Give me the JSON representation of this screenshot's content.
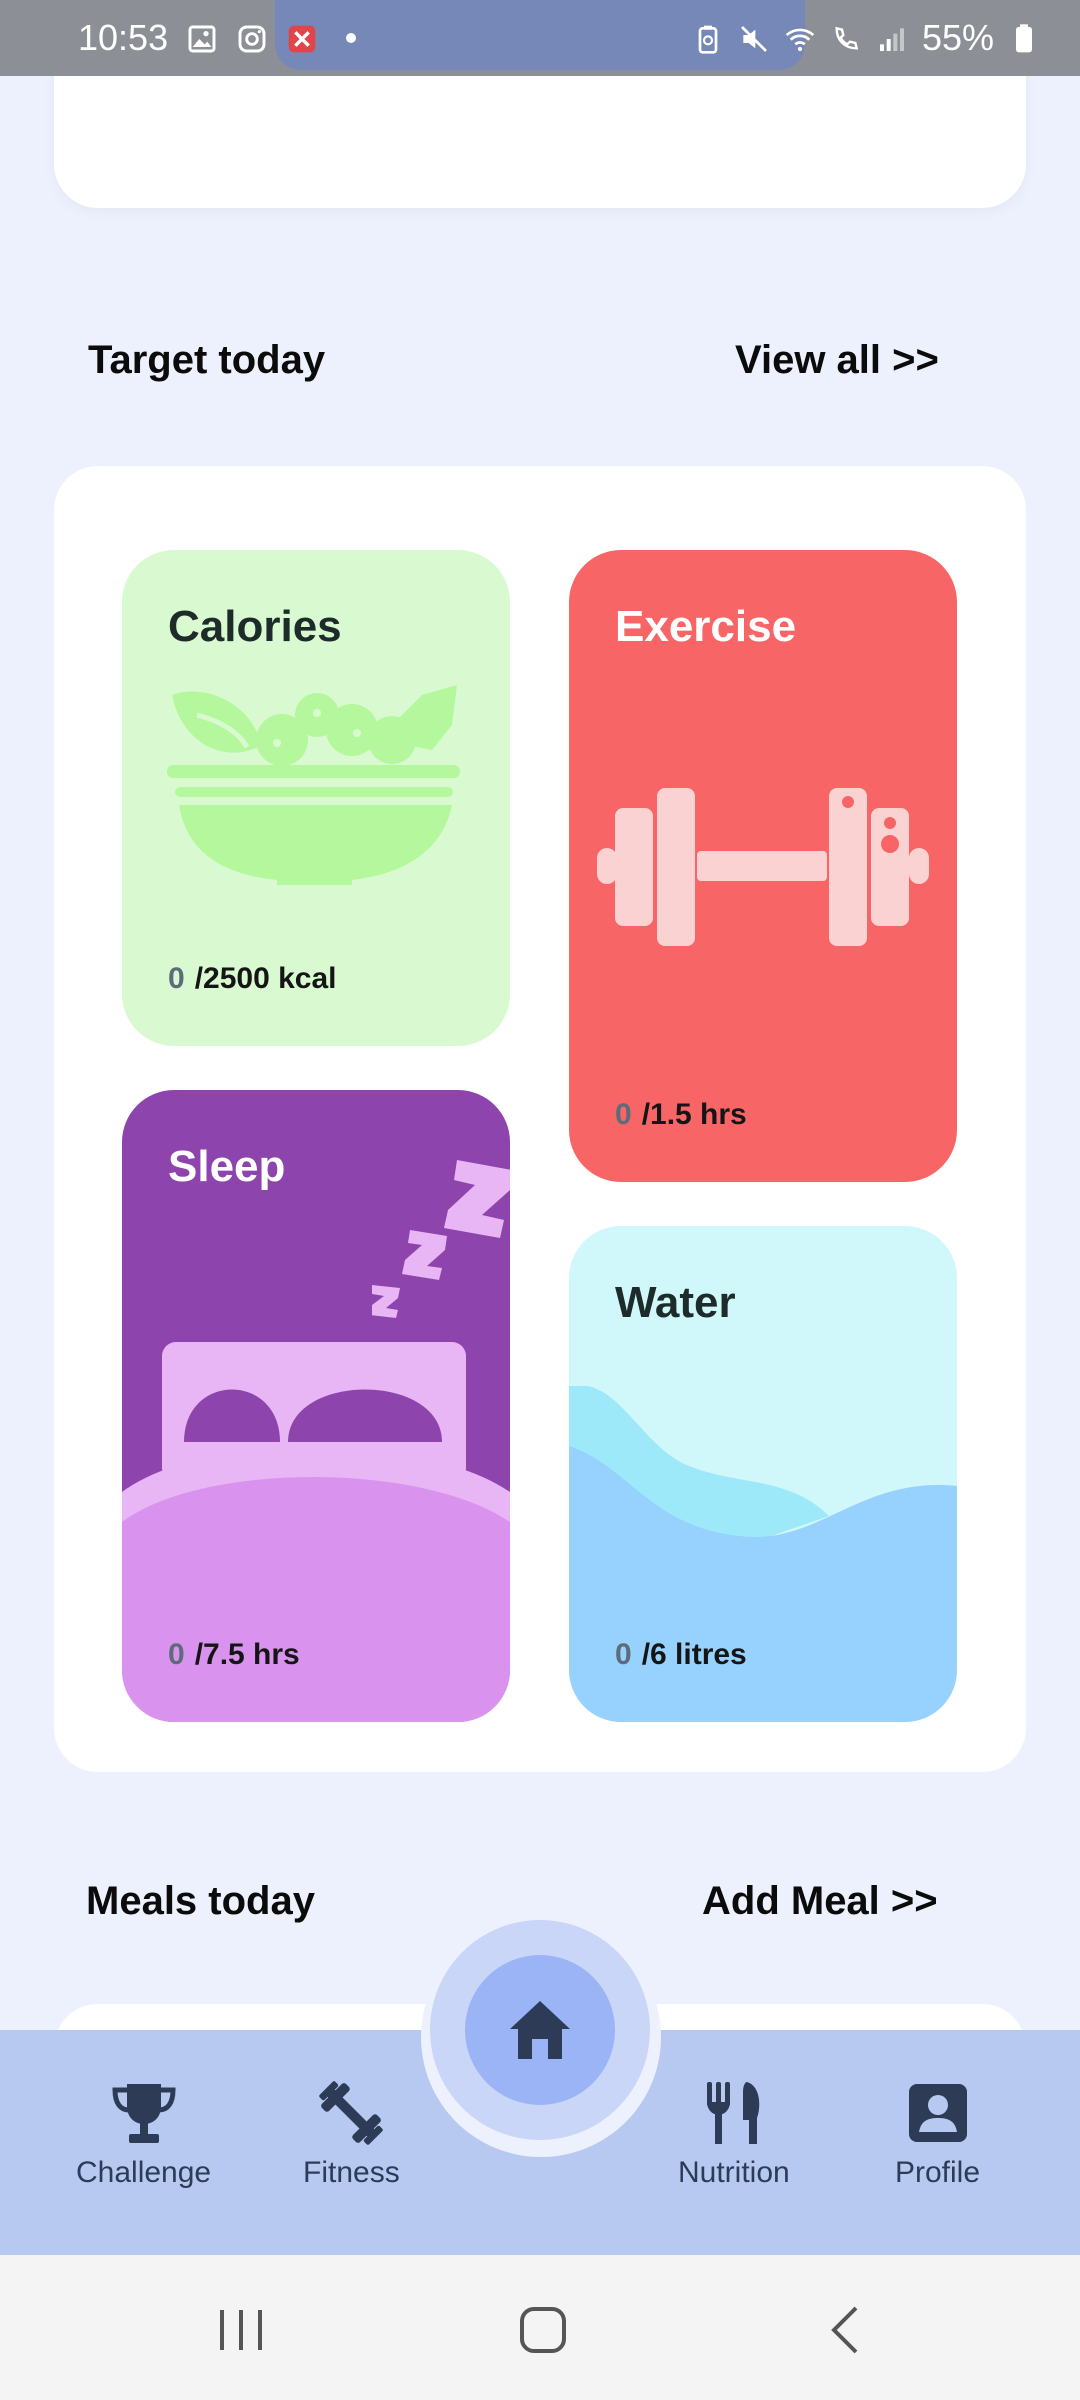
{
  "status_bar": {
    "time": "10:53",
    "battery": "55%",
    "icons_left": [
      "gallery-icon",
      "instagram-icon",
      "app-notification-icon"
    ],
    "icons_right": [
      "battery-saver-icon",
      "mute-icon",
      "wifi-icon",
      "wifi-calling-icon",
      "signal-icon",
      "battery-icon"
    ]
  },
  "target_section": {
    "title": "Target today",
    "view_all": "View all >>"
  },
  "tiles": {
    "calories": {
      "title": "Calories",
      "current": "0",
      "target": "/2500 kcal",
      "color": "#d9fad0",
      "icon": "salad-bowl"
    },
    "exercise": {
      "title": "Exercise",
      "current": "0",
      "target": "/1.5 hrs",
      "color": "#f86566",
      "icon": "dumbbell"
    },
    "sleep": {
      "title": "Sleep",
      "current": "0",
      "target": "/7.5 hrs",
      "color": "#8e44ad",
      "icon": "bed-zzz"
    },
    "water": {
      "title": "Water",
      "current": "0",
      "target": "/6 litres",
      "color": "#d0f8fa",
      "icon": "water-waves"
    }
  },
  "meals_section": {
    "title": "Meals today",
    "add_meal": "Add Meal >>"
  },
  "bottom_nav": {
    "items": [
      {
        "label": "Challenge",
        "icon": "trophy-icon"
      },
      {
        "label": "Fitness",
        "icon": "dumbbell-icon"
      },
      {
        "label": "Nutrition",
        "icon": "fork-knife-icon"
      },
      {
        "label": "Profile",
        "icon": "profile-icon"
      }
    ],
    "home_icon": "home-icon"
  },
  "colors": {
    "background": "#ecf1fd",
    "nav_bar": "#b8c9f1",
    "home_button": "#9bb4f5",
    "nav_icon": "#2d3b57"
  }
}
